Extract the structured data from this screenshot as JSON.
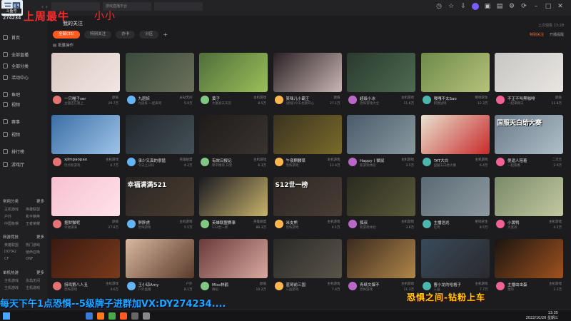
{
  "window": {
    "tabs": [
      "",
      "游戏直播平台",
      ""
    ],
    "title": "我的关注"
  },
  "overlay": {
    "logo": "三国",
    "badge": "斗鱼号",
    "room_id": "274234",
    "title_red": "上周最牛",
    "title_red2": "小小",
    "ticker": "每天下午1点恐惧--5级牌子进群加VX:DY274234....",
    "promo": "恐惧之间-钻粉上车"
  },
  "sidebar": {
    "items": [
      {
        "label": "首页",
        "icon": "home-icon"
      },
      {
        "label": "全部直播",
        "icon": "grid-icon"
      },
      {
        "label": "全部分类",
        "icon": "category-icon"
      },
      {
        "label": "活动中心",
        "icon": "gift-icon"
      },
      {
        "label": "鱼吧",
        "icon": "fish-icon"
      },
      {
        "label": "视频",
        "icon": "video-icon"
      },
      {
        "label": "赛事",
        "icon": "trophy-icon"
      },
      {
        "label": "视频",
        "icon": "play-icon"
      },
      {
        "label": "排行榜",
        "icon": "rank-icon"
      },
      {
        "label": "游戏厅",
        "icon": "game-icon"
      }
    ],
    "groups": [
      {
        "label": "常用分类",
        "more": "更多"
      },
      {
        "label": "网游竞技",
        "more": "更多"
      },
      {
        "label": "单机热游",
        "more": "更多"
      }
    ],
    "subs": [
      [
        "主机游戏",
        "英雄联盟"
      ],
      [
        "户外",
        "和平精英"
      ],
      [
        "中国象棋",
        "王者荣耀"
      ],
      [
        "英雄联盟",
        "热门游戏"
      ],
      [
        "DOTA2",
        "使命召唤"
      ],
      [
        "CF",
        "DNF"
      ],
      [
        "主机游戏",
        "永劫无间"
      ],
      [
        "主机游戏",
        "主机游戏"
      ]
    ]
  },
  "filters": {
    "chips": [
      "全部(35)",
      "特别关注",
      "办卡",
      "分区"
    ],
    "add": "+",
    "manage": "批量操作",
    "right_hint": "上次观看 13:28",
    "right_links": [
      "特别关注",
      "开播提醒"
    ]
  },
  "cards": [
    {
      "name": "一只喵子ser",
      "cat": "颜值",
      "sub": "主播还在路上",
      "heat": "29.7万"
    },
    {
      "name": "九层妖",
      "cat": "永劫无间",
      "sub": "九层妖 一起来吧",
      "heat": "5.9万"
    },
    {
      "name": "黄子",
      "cat": "主机游戏",
      "sub": "大富翁天天见",
      "heat": "8.5万"
    },
    {
      "name": "笑咪儿小霸王",
      "cat": "颜值",
      "sub": "(颜值)今天也要开心",
      "heat": "27.1万"
    },
    {
      "name": "超级小冰",
      "cat": "主机游戏",
      "sub": "恐怖游戏大全",
      "heat": "11.6万"
    },
    {
      "name": "哦嘎不太Sao",
      "cat": "绝地求生",
      "sub": "刺激战场",
      "heat": "12.3万"
    },
    {
      "name": "不正不叫黑咖啡",
      "cat": "颜值",
      "sub": "一起来聊天",
      "heat": "11.8万"
    },
    {
      "name": "xjlmpaopao",
      "cat": "主机游戏",
      "sub": "玩点新游戏",
      "heat": "6.7万"
    },
    {
      "name": "承少又真的很猛",
      "cat": "英雄联盟",
      "sub": "今天上分吗",
      "heat": "4.2万"
    },
    {
      "name": "有效日报记",
      "cat": "主机游戏",
      "sub": "和平精英 开黑",
      "heat": "6.3万"
    },
    {
      "name": "午夜麒麟菜",
      "cat": "主机游戏",
      "sub": "恐怖游戏",
      "heat": "12.4万"
    },
    {
      "name": "Happy丨猫鼠",
      "cat": "主机游戏",
      "sub": "新游戏体验",
      "heat": "3.5万"
    },
    {
      "name": "TAT大白",
      "cat": "主机游戏",
      "sub": "国服天白给大赛",
      "heat": "6.4万"
    },
    {
      "name": "傻逼人陪着",
      "cat": "二次元",
      "sub": "一起看番",
      "heat": "2.9万"
    },
    {
      "name": "抠财猫呢",
      "cat": "颜值",
      "sub": "幸福满满",
      "heat": "27.8万"
    },
    {
      "name": "胖胖虎",
      "cat": "主机游戏",
      "sub": "恐怖游戏",
      "heat": "5.5万"
    },
    {
      "name": "英雄联盟赛事",
      "cat": "英雄联盟",
      "sub": "S12世一榜",
      "heat": "88.3万"
    },
    {
      "name": "米支熊",
      "cat": "主机游戏",
      "sub": "恐怖游戏",
      "heat": "4.1万"
    },
    {
      "name": "狐叔",
      "cat": "主机游戏",
      "sub": "新游戏体验",
      "heat": "3.6万"
    },
    {
      "name": "主播浩兆",
      "cat": "绝地求生",
      "sub": "吃鸡",
      "heat": "8.5万"
    },
    {
      "name": "小黄鸭",
      "cat": "主机游戏",
      "sub": "大富翁",
      "heat": "4.2万"
    },
    {
      "name": "捞鸡第八人丑",
      "cat": "主机游戏",
      "sub": "恐怖游戏",
      "heat": "4.6万"
    },
    {
      "name": "王小琼Amy",
      "cat": "户外",
      "sub": "户外直播",
      "heat": "8.1万"
    },
    {
      "name": "Miss林鹤",
      "cat": "颜值",
      "sub": "舞蹈",
      "heat": "10.2万"
    },
    {
      "name": "蓝哥前三国",
      "cat": "主机游戏",
      "sub": "三国游戏",
      "heat": "7.4万"
    },
    {
      "name": "青纸文爆不",
      "cat": "主机游戏",
      "sub": "恐怖游戏",
      "heat": "11.3万"
    },
    {
      "name": "曹小龙的哈格子",
      "cat": "主机游戏",
      "sub": "三国",
      "heat": "7.7万"
    },
    {
      "name": "主播虫虫蛋",
      "cat": "主机游戏",
      "sub": "星际",
      "heat": "2.2万"
    }
  ],
  "thumb_labels": {
    "c15": "幸福满满521",
    "c17": "S12世一榜",
    "c13": "国服天白给大赛"
  },
  "taskbar": {
    "time": "13:35",
    "date": "2022/10/26 星期三"
  },
  "colors": {
    "accent": "#ff5a1f",
    "bg": "#1c1c1f",
    "overlay_red": "#ff2b2b",
    "ticker_blue": "#1aa9ff"
  }
}
